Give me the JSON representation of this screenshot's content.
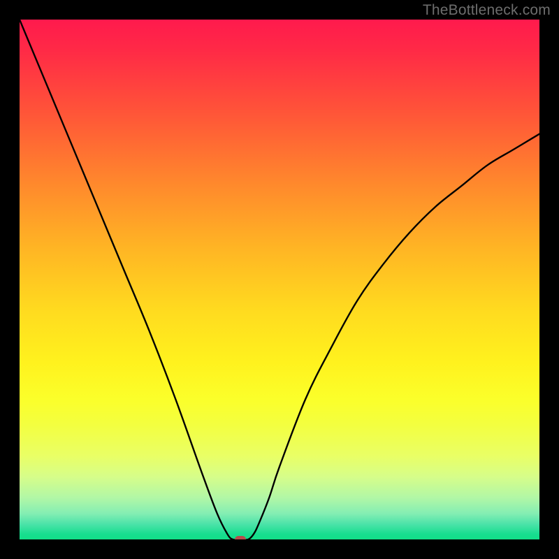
{
  "credit_text": "TheBottleneck.com",
  "colors": {
    "marker": "#b84c4c",
    "curve": "#000000"
  },
  "chart_data": {
    "type": "line",
    "title": "",
    "xlabel": "",
    "ylabel": "",
    "xlim": [
      0,
      100
    ],
    "ylim": [
      0,
      100
    ],
    "grid": false,
    "series": [
      {
        "name": "bottleneck-curve",
        "x": [
          0,
          5,
          10,
          15,
          20,
          25,
          30,
          35,
          38,
          40,
          41,
          42,
          43,
          44,
          45,
          46,
          48,
          50,
          55,
          60,
          65,
          70,
          75,
          80,
          85,
          90,
          95,
          100
        ],
        "y": [
          100,
          88,
          76,
          64,
          52,
          40,
          27,
          13,
          5,
          1,
          0,
          0,
          0,
          0,
          1,
          3,
          8,
          14,
          27,
          37,
          46,
          53,
          59,
          64,
          68,
          72,
          75,
          78
        ]
      }
    ],
    "minimum_marker": {
      "x": 42.5,
      "y": 0
    },
    "background_gradient": {
      "top": "#ff1a4d",
      "mid": "#fff21e",
      "bottom": "#12df88"
    }
  }
}
